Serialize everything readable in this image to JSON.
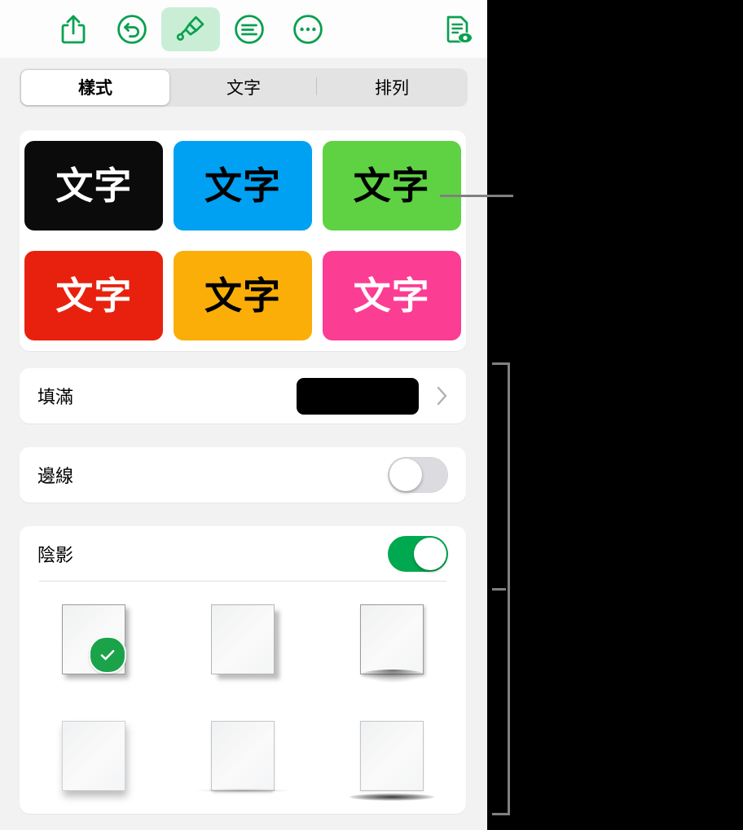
{
  "toolbar": {
    "items": [
      {
        "name": "share-icon",
        "label": "共享",
        "selected": false
      },
      {
        "name": "undo-icon",
        "label": "還原",
        "selected": false
      },
      {
        "name": "paintbrush-icon",
        "label": "格式",
        "selected": true
      },
      {
        "name": "insert-icon",
        "label": "插入",
        "selected": false
      },
      {
        "name": "more-icon",
        "label": "更多",
        "selected": false
      },
      {
        "name": "document-view-icon",
        "label": "文件",
        "selected": false
      }
    ]
  },
  "tabs": {
    "items": [
      {
        "label": "樣式",
        "active": true
      },
      {
        "label": "文字",
        "active": false
      },
      {
        "label": "排列",
        "active": false
      }
    ]
  },
  "styles": {
    "swatches": [
      {
        "text": "文字",
        "bg": "#0b0b0b",
        "fg": "#ffffff"
      },
      {
        "text": "文字",
        "bg": "#00a1f3",
        "fg": "#000000"
      },
      {
        "text": "文字",
        "bg": "#5ed243",
        "fg": "#000000"
      },
      {
        "text": "文字",
        "bg": "#e8210f",
        "fg": "#ffffff"
      },
      {
        "text": "文字",
        "bg": "#fbae08",
        "fg": "#000000"
      },
      {
        "text": "文字",
        "bg": "#fc3d94",
        "fg": "#ffffff"
      }
    ]
  },
  "fill": {
    "label": "填滿",
    "color": "#000000",
    "chevron": "chevron-right-icon"
  },
  "border": {
    "label": "邊線",
    "enabled": false
  },
  "shadow": {
    "label": "陰影",
    "enabled": true,
    "presets": [
      {
        "name": "drop-shadow",
        "selected": true
      },
      {
        "name": "contact-shadow",
        "selected": false
      },
      {
        "name": "curved-shadow",
        "selected": false
      },
      {
        "name": "soft-shadow",
        "selected": false
      },
      {
        "name": "flat-shadow",
        "selected": false
      },
      {
        "name": "line-shadow",
        "selected": false
      }
    ],
    "check_icon": "checkmark-icon"
  },
  "colors": {
    "accent_green": "#00a94f",
    "toolbar_green": "#0aa050",
    "selected_tool_bg": "#c9eed5",
    "panel_bg": "#f2f2f2",
    "card_bg": "#ffffff",
    "callout_gray": "#808080"
  }
}
